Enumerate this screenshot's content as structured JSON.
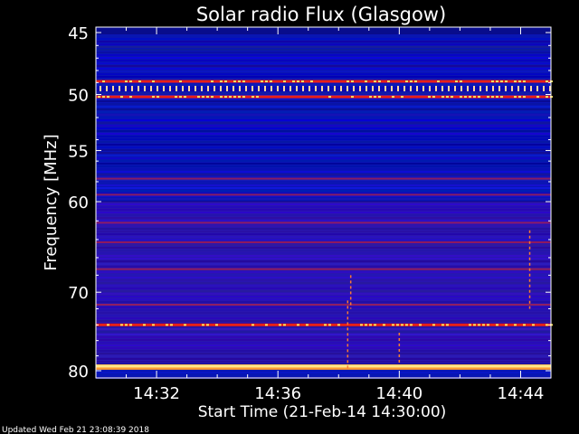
{
  "chart_data": {
    "type": "heatmap",
    "title": "Solar radio Flux (Glasgow)",
    "ylabel": "Frequency [MHz]",
    "xlabel": "Start Time (21-Feb-14 14:30:00)",
    "x_ticks": [
      "14:32",
      "14:36",
      "14:40",
      "14:44"
    ],
    "y_ticks": [
      "45",
      "50",
      "55",
      "60",
      "70",
      "80"
    ],
    "y_tick_values": [
      45,
      50,
      55,
      60,
      70,
      80
    ],
    "x_tick_minutes": [
      32,
      36,
      40,
      44
    ],
    "xlim": [
      "14:30",
      "14:45"
    ],
    "ylim": [
      44,
      80
    ],
    "y_scale": "log",
    "y_inverted": true,
    "colormap": "blue-red-yellow",
    "intense_bands_mhz": [
      {
        "freq": 48.9,
        "level": "high"
      },
      {
        "freq": 49.5,
        "level": "dotted"
      },
      {
        "freq": 50.2,
        "level": "high"
      },
      {
        "freq": 57.7,
        "level": "medium"
      },
      {
        "freq": 59.3,
        "level": "medium"
      },
      {
        "freq": 62.2,
        "level": "medium"
      },
      {
        "freq": 64.3,
        "level": "medium"
      },
      {
        "freq": 67.3,
        "level": "medium"
      },
      {
        "freq": 71.5,
        "level": "medium"
      },
      {
        "freq": 74.0,
        "level": "high"
      },
      {
        "freq": 79.5,
        "level": "very-high"
      }
    ]
  },
  "footer": {
    "updated": "Updated Wed Feb 21 23:08:39 2018"
  },
  "colors": {
    "background": "#000000",
    "low": "#0a10c8",
    "mid": "#c81818",
    "high": "#ffd020"
  }
}
